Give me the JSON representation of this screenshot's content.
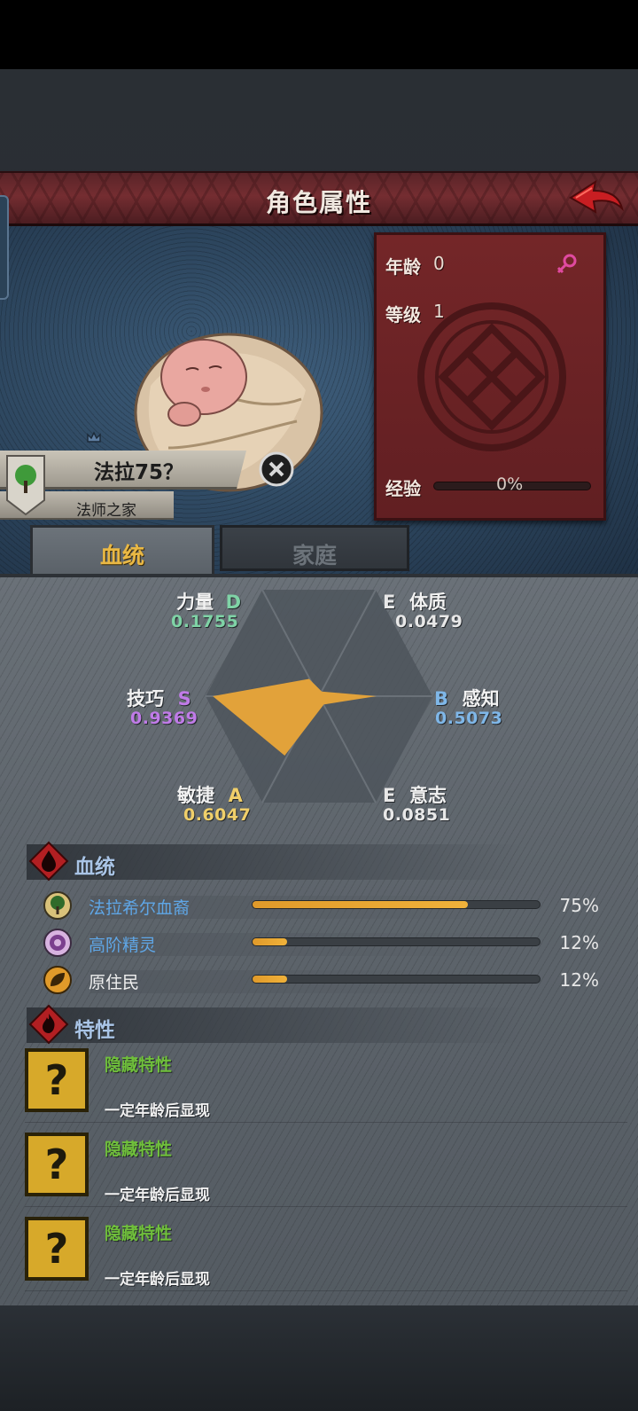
{
  "header": {
    "title": "角色属性"
  },
  "character": {
    "name": "法拉75？",
    "house": "法师之家",
    "age_label": "年龄",
    "age": "0",
    "level_label": "等级",
    "level": "1",
    "exp_label": "经验",
    "exp_pct": "0%",
    "exp_fraction": 0.0
  },
  "tabs": [
    {
      "label": "血统",
      "active": true
    },
    {
      "label": "家庭",
      "active": false
    }
  ],
  "attributes": {
    "strength": {
      "name": "力量",
      "grade": "D",
      "value": "0.1755"
    },
    "constitution": {
      "name": "体质",
      "grade": "E",
      "value": "0.0479"
    },
    "skill": {
      "name": "技巧",
      "grade": "S",
      "value": "0.9369"
    },
    "perception": {
      "name": "感知",
      "grade": "B",
      "value": "0.5073"
    },
    "agility": {
      "name": "敏捷",
      "grade": "A",
      "value": "0.6047"
    },
    "will": {
      "name": "意志",
      "grade": "E",
      "value": "0.0851"
    }
  },
  "bloodline_section": {
    "title": "血统",
    "rows": [
      {
        "label": "法拉希尔血裔",
        "pct": "75%",
        "fraction": 0.75,
        "color": "#5fa6e6",
        "icon": "tree-emblem-icon"
      },
      {
        "label": "高阶精灵",
        "pct": "12%",
        "fraction": 0.12,
        "color": "#5fa6e6",
        "icon": "elf-emblem-icon"
      },
      {
        "label": "原住民",
        "pct": "12%",
        "fraction": 0.12,
        "color": "#f0f0f0",
        "icon": "leaf-emblem-icon"
      }
    ]
  },
  "traits_section": {
    "title": "特性",
    "rows": [
      {
        "name": "隐藏特性",
        "desc": "一定年龄后显现"
      },
      {
        "name": "隐藏特性",
        "desc": "一定年龄后显现"
      },
      {
        "name": "隐藏特性",
        "desc": "一定年龄后显现"
      }
    ]
  },
  "colors": {
    "header_red": "#742d31",
    "grade_green": "#7fd3a6",
    "grade_purple": "#c07be8",
    "grade_blue": "#7fb7e8",
    "grade_yellow": "#f0cf6a",
    "grade_white": "#e8e8e8",
    "radar_fill": "#e2a23a",
    "trait_green": "#6fbf3b"
  }
}
